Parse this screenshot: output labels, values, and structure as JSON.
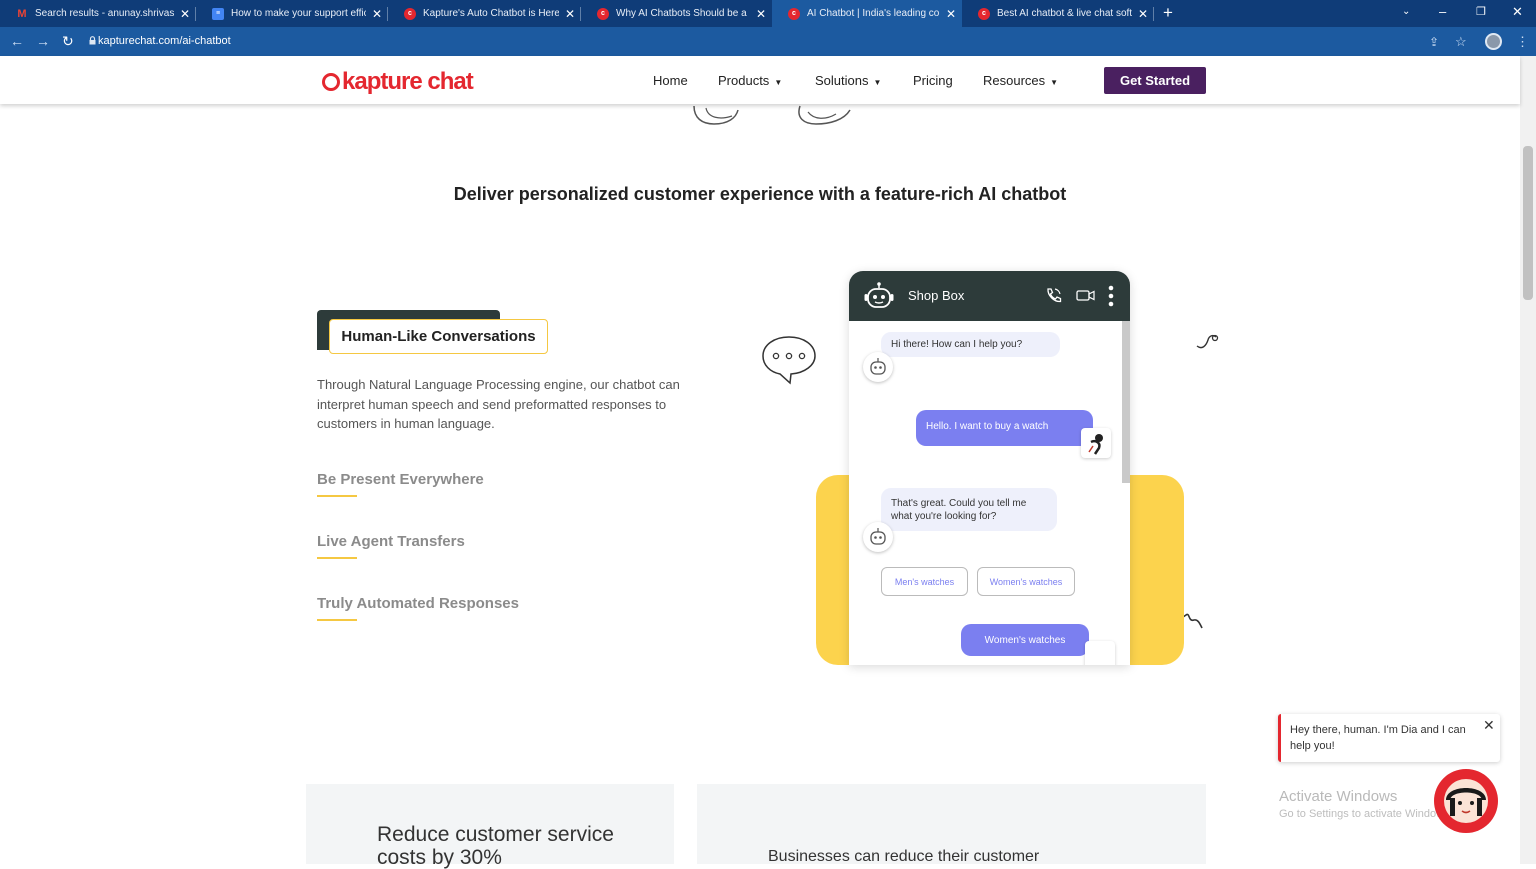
{
  "browser": {
    "tabs": [
      {
        "title": "Search results - anunay.shrivastav",
        "favicon": "gmail-icon",
        "color": "#d93025"
      },
      {
        "title": "How to make your support efficie",
        "favicon": "docs-icon",
        "color": "#4285f4"
      },
      {
        "title": "Kapture's Auto Chatbot is Here to",
        "favicon": "kapture-icon",
        "color": "#e4272f"
      },
      {
        "title": "Why AI Chatbots Should be a Par",
        "favicon": "kapture-icon",
        "color": "#e4272f"
      },
      {
        "title": "AI Chatbot | India's leading conve",
        "favicon": "kapture-icon",
        "color": "#e4272f",
        "active": true
      },
      {
        "title": "Best AI chatbot & live chat softw",
        "favicon": "kapture-icon",
        "color": "#e4272f"
      }
    ],
    "url": "kapturechat.com/ai-chatbot"
  },
  "header": {
    "logo": "kapture chat",
    "nav": {
      "home": "Home",
      "products": "Products",
      "solutions": "Solutions",
      "pricing": "Pricing",
      "resources": "Resources"
    },
    "cta": "Get Started"
  },
  "section": {
    "heading": "Deliver personalized customer experience with a feature-rich AI chatbot",
    "active_feature": {
      "title": "Human-Like Conversations",
      "description": "Through Natural Language Processing engine, our chatbot can interpret human speech and send preformatted responses to customers in human language."
    },
    "features": [
      "Be Present Everywhere",
      "Live Agent Transfers",
      "Truly Automated Responses"
    ]
  },
  "chat_demo": {
    "title": "Shop Box",
    "messages": {
      "bot_1": "Hi there! How can I help you?",
      "user_1": "Hello. I want to buy a watch",
      "bot_2": "That's great. Could you tell me what you're looking for?",
      "user_2": "Women's watches"
    },
    "options": [
      "Men's watches",
      "Women's watches"
    ]
  },
  "cards": {
    "left_title": "Reduce customer service costs by 30%",
    "right_title": "Businesses can reduce their customer"
  },
  "widget": {
    "message": "Hey there, human. I'm Dia and I can help you!"
  },
  "os_watermark": {
    "line1": "Activate Windows",
    "line2": "Go to Settings to activate Windows."
  },
  "colors": {
    "brand_red": "#e4272f",
    "cta_purple": "#4a2060",
    "accent_yellow": "#fcd34d",
    "chat_header": "#2d3b3a",
    "user_bubble": "#7b7ff0"
  }
}
